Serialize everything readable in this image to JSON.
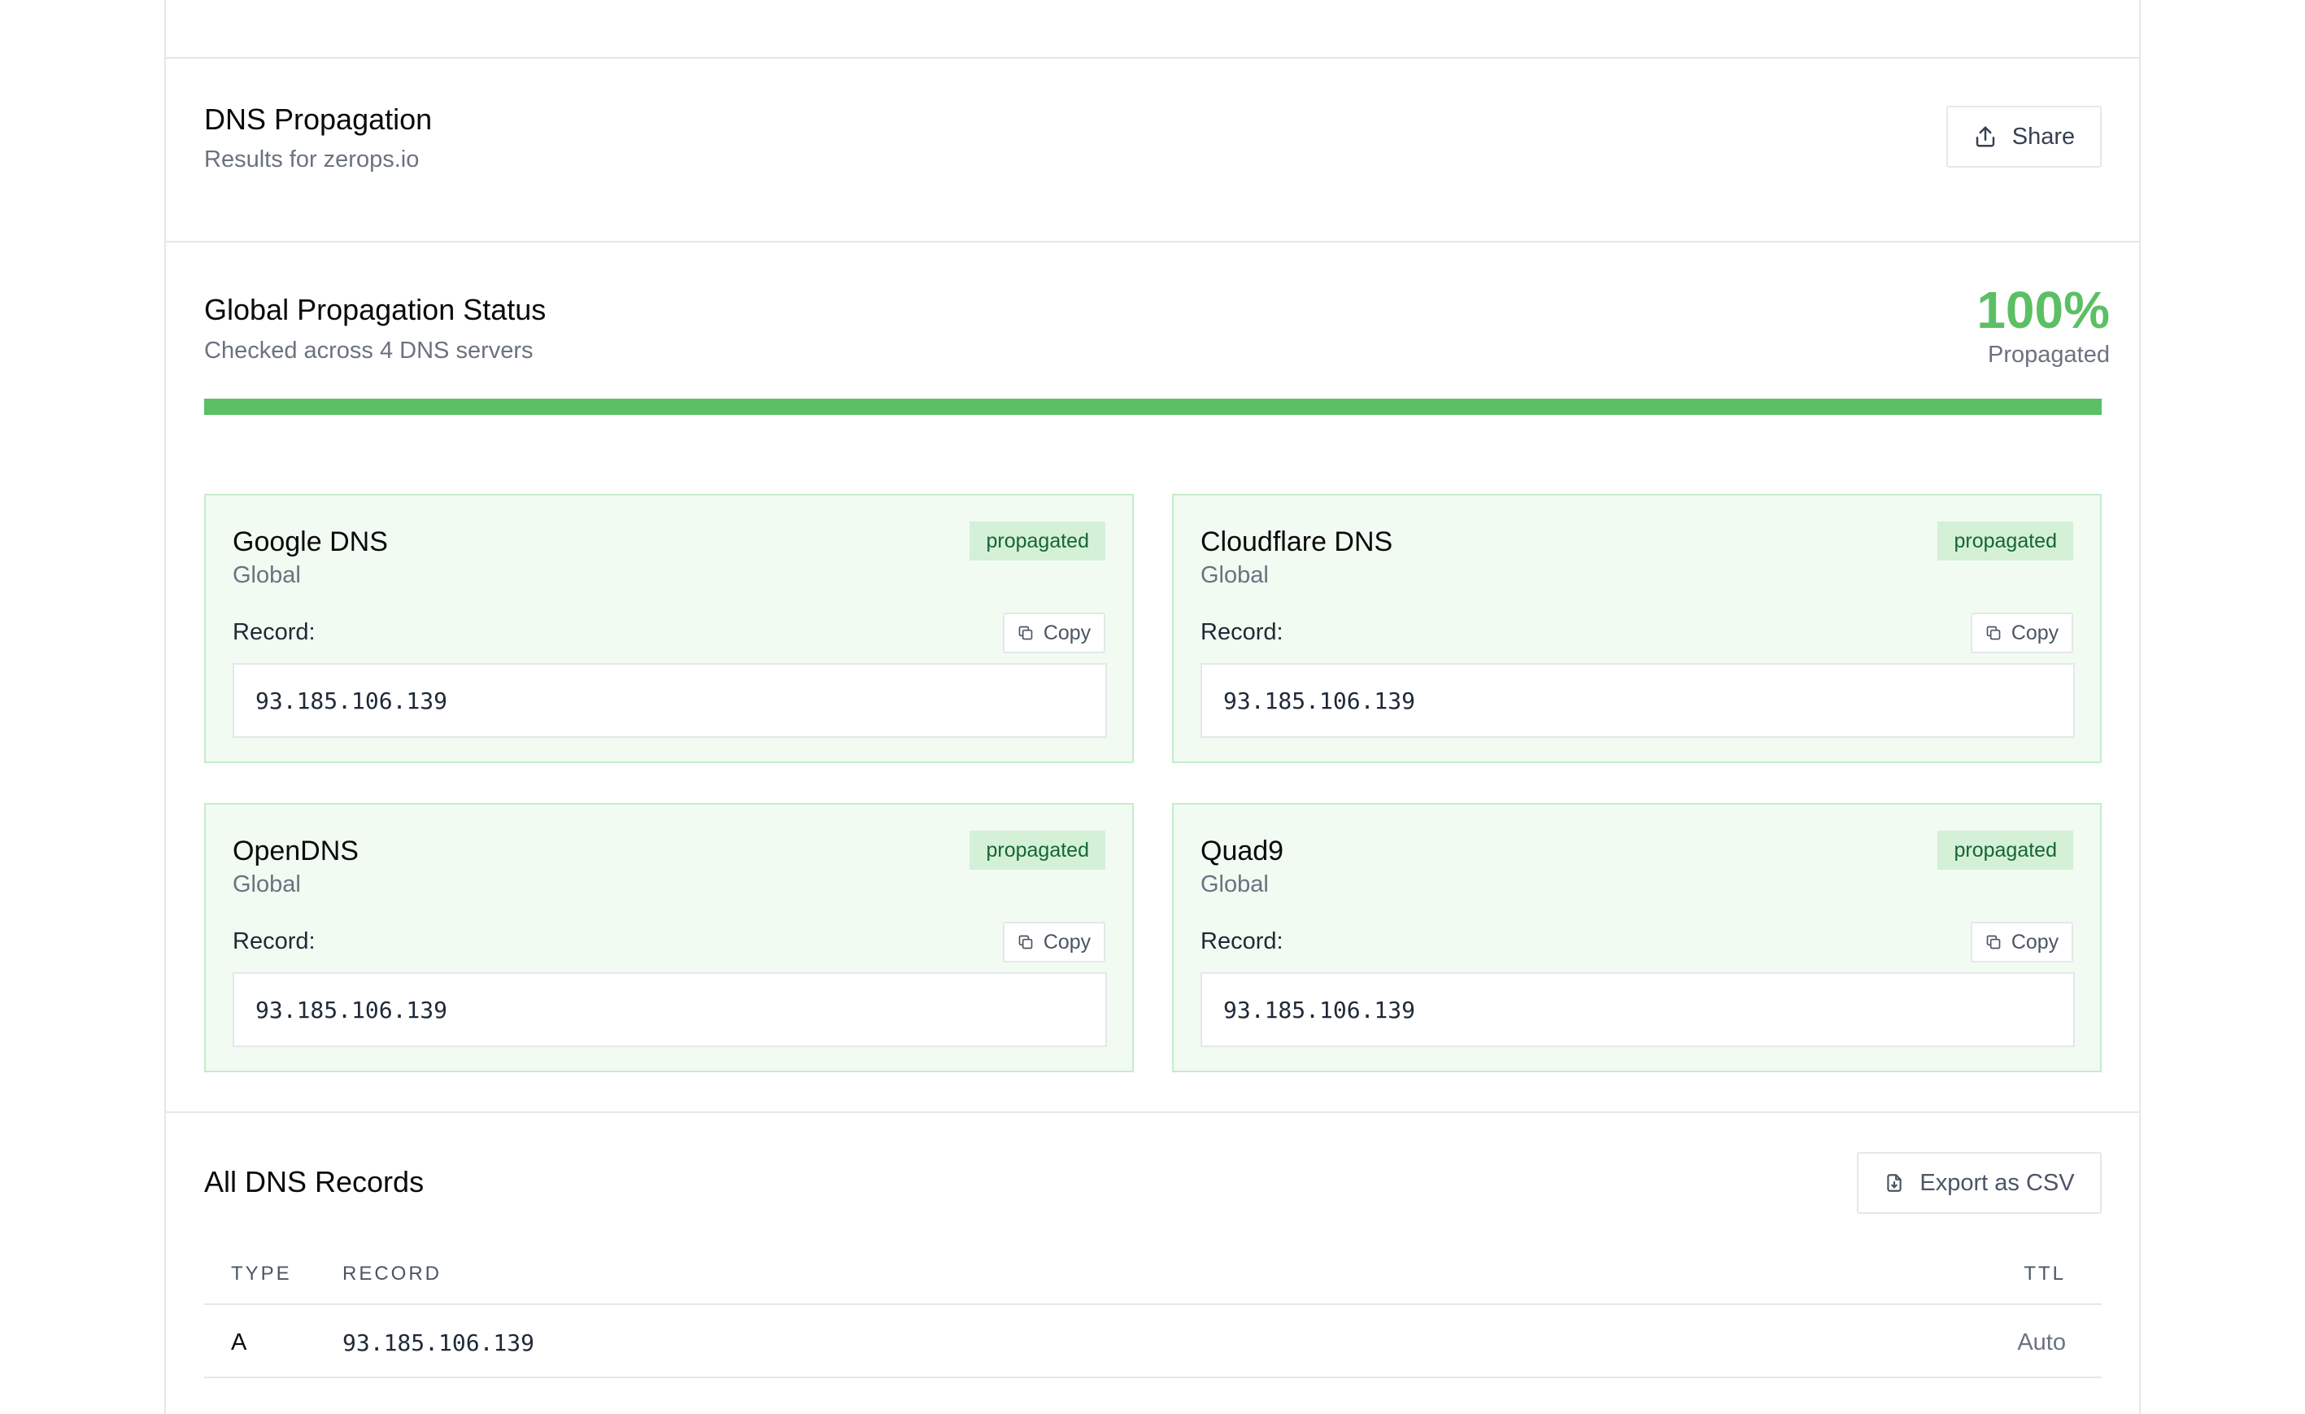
{
  "header": {
    "title": "DNS Propagation",
    "subtitle": "Results for zerops.io",
    "share_label": "Share"
  },
  "status": {
    "title": "Global Propagation Status",
    "subtitle": "Checked across 4 DNS servers",
    "percent": "100%",
    "percent_label": "Propagated",
    "progress_fraction": 1.0,
    "accent_color": "#5cbf64"
  },
  "servers": [
    {
      "name": "Google DNS",
      "region": "Global",
      "status": "propagated",
      "record_label": "Record:",
      "copy_label": "Copy",
      "record": "93.185.106.139"
    },
    {
      "name": "Cloudflare DNS",
      "region": "Global",
      "status": "propagated",
      "record_label": "Record:",
      "copy_label": "Copy",
      "record": "93.185.106.139"
    },
    {
      "name": "OpenDNS",
      "region": "Global",
      "status": "propagated",
      "record_label": "Record:",
      "copy_label": "Copy",
      "record": "93.185.106.139"
    },
    {
      "name": "Quad9",
      "region": "Global",
      "status": "propagated",
      "record_label": "Record:",
      "copy_label": "Copy",
      "record": "93.185.106.139"
    }
  ],
  "records": {
    "title": "All DNS Records",
    "export_label": "Export as CSV",
    "columns": [
      "TYPE",
      "RECORD",
      "TTL"
    ],
    "rows": [
      {
        "type": "A",
        "record": "93.185.106.139",
        "ttl": "Auto"
      }
    ]
  }
}
